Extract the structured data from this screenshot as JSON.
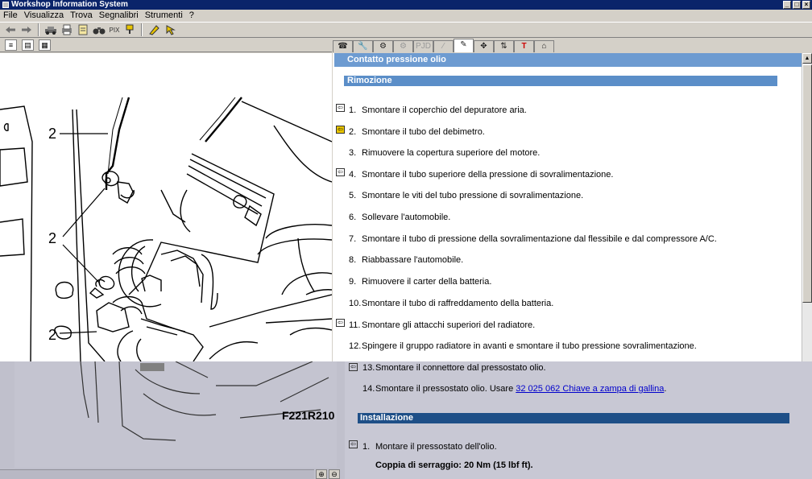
{
  "window": {
    "title": "Workshop Information System",
    "controls": [
      "_",
      "□",
      "×"
    ]
  },
  "menu": [
    "File",
    "Visualizza",
    "Trova",
    "Segnalibri",
    "Strumenti",
    "?"
  ],
  "toolbar": {
    "text_button": "PIX"
  },
  "left_tabs": [
    "≡",
    "▤",
    "▦"
  ],
  "right_tabs": [
    "☎",
    "🔧",
    "⚙",
    "⚙",
    "PJD",
    "⁄",
    "✎",
    "✥",
    "⇅",
    "T",
    "⌂"
  ],
  "illustration": {
    "callouts": [
      "2",
      "2",
      "2"
    ],
    "figure_id": "F221R210"
  },
  "zoom": [
    "⊕",
    "⊖"
  ],
  "document": {
    "header": "Contatto pressione olio",
    "section_removal": "Rimozione",
    "steps": [
      {
        "num": "1.",
        "text": "Smontare il coperchio del depuratore aria."
      },
      {
        "num": "2.",
        "text": "Smontare il tubo del debimetro."
      },
      {
        "num": "3.",
        "text": "Rimuovere la copertura superiore del motore."
      },
      {
        "num": "4.",
        "text": "Smontare il tubo superiore della pressione di sovralimentazione."
      },
      {
        "num": "5.",
        "text": "Smontare le viti del tubo pressione di sovralimentazione."
      },
      {
        "num": "6.",
        "text": "Sollevare l'automobile."
      },
      {
        "num": "7.",
        "text": "Smontare il tubo di pressione della sovralimentazione dal flessibile e dal compressore A/C."
      },
      {
        "num": "8.",
        "text": "Riabbassare l'automobile."
      },
      {
        "num": "9.",
        "text": "Rimuovere il carter della batteria."
      },
      {
        "num": "10.",
        "text": "Smontare il tubo di raffreddamento della batteria."
      },
      {
        "num": "11.",
        "text": "Smontare gli attacchi superiori del radiatore."
      },
      {
        "num": "12.",
        "text": "Spingere il gruppo radiatore in avanti e smontare il tubo pressione sovralimentazione."
      },
      {
        "num": "13.",
        "text": "Smontare il connettore dal pressostato olio."
      },
      {
        "num": "14.",
        "text": "Smontare il pressostato olio. Usare "
      }
    ],
    "step14_link": "32 025 062 Chiave a zampa di gallina",
    "step14_end": ".",
    "section_install": "Installazione",
    "install_steps": [
      {
        "num": "1.",
        "text": "Montare il pressostato dell'olio."
      }
    ],
    "torque": "Coppia di serraggio: 20 Nm (15 lbf ft)."
  }
}
